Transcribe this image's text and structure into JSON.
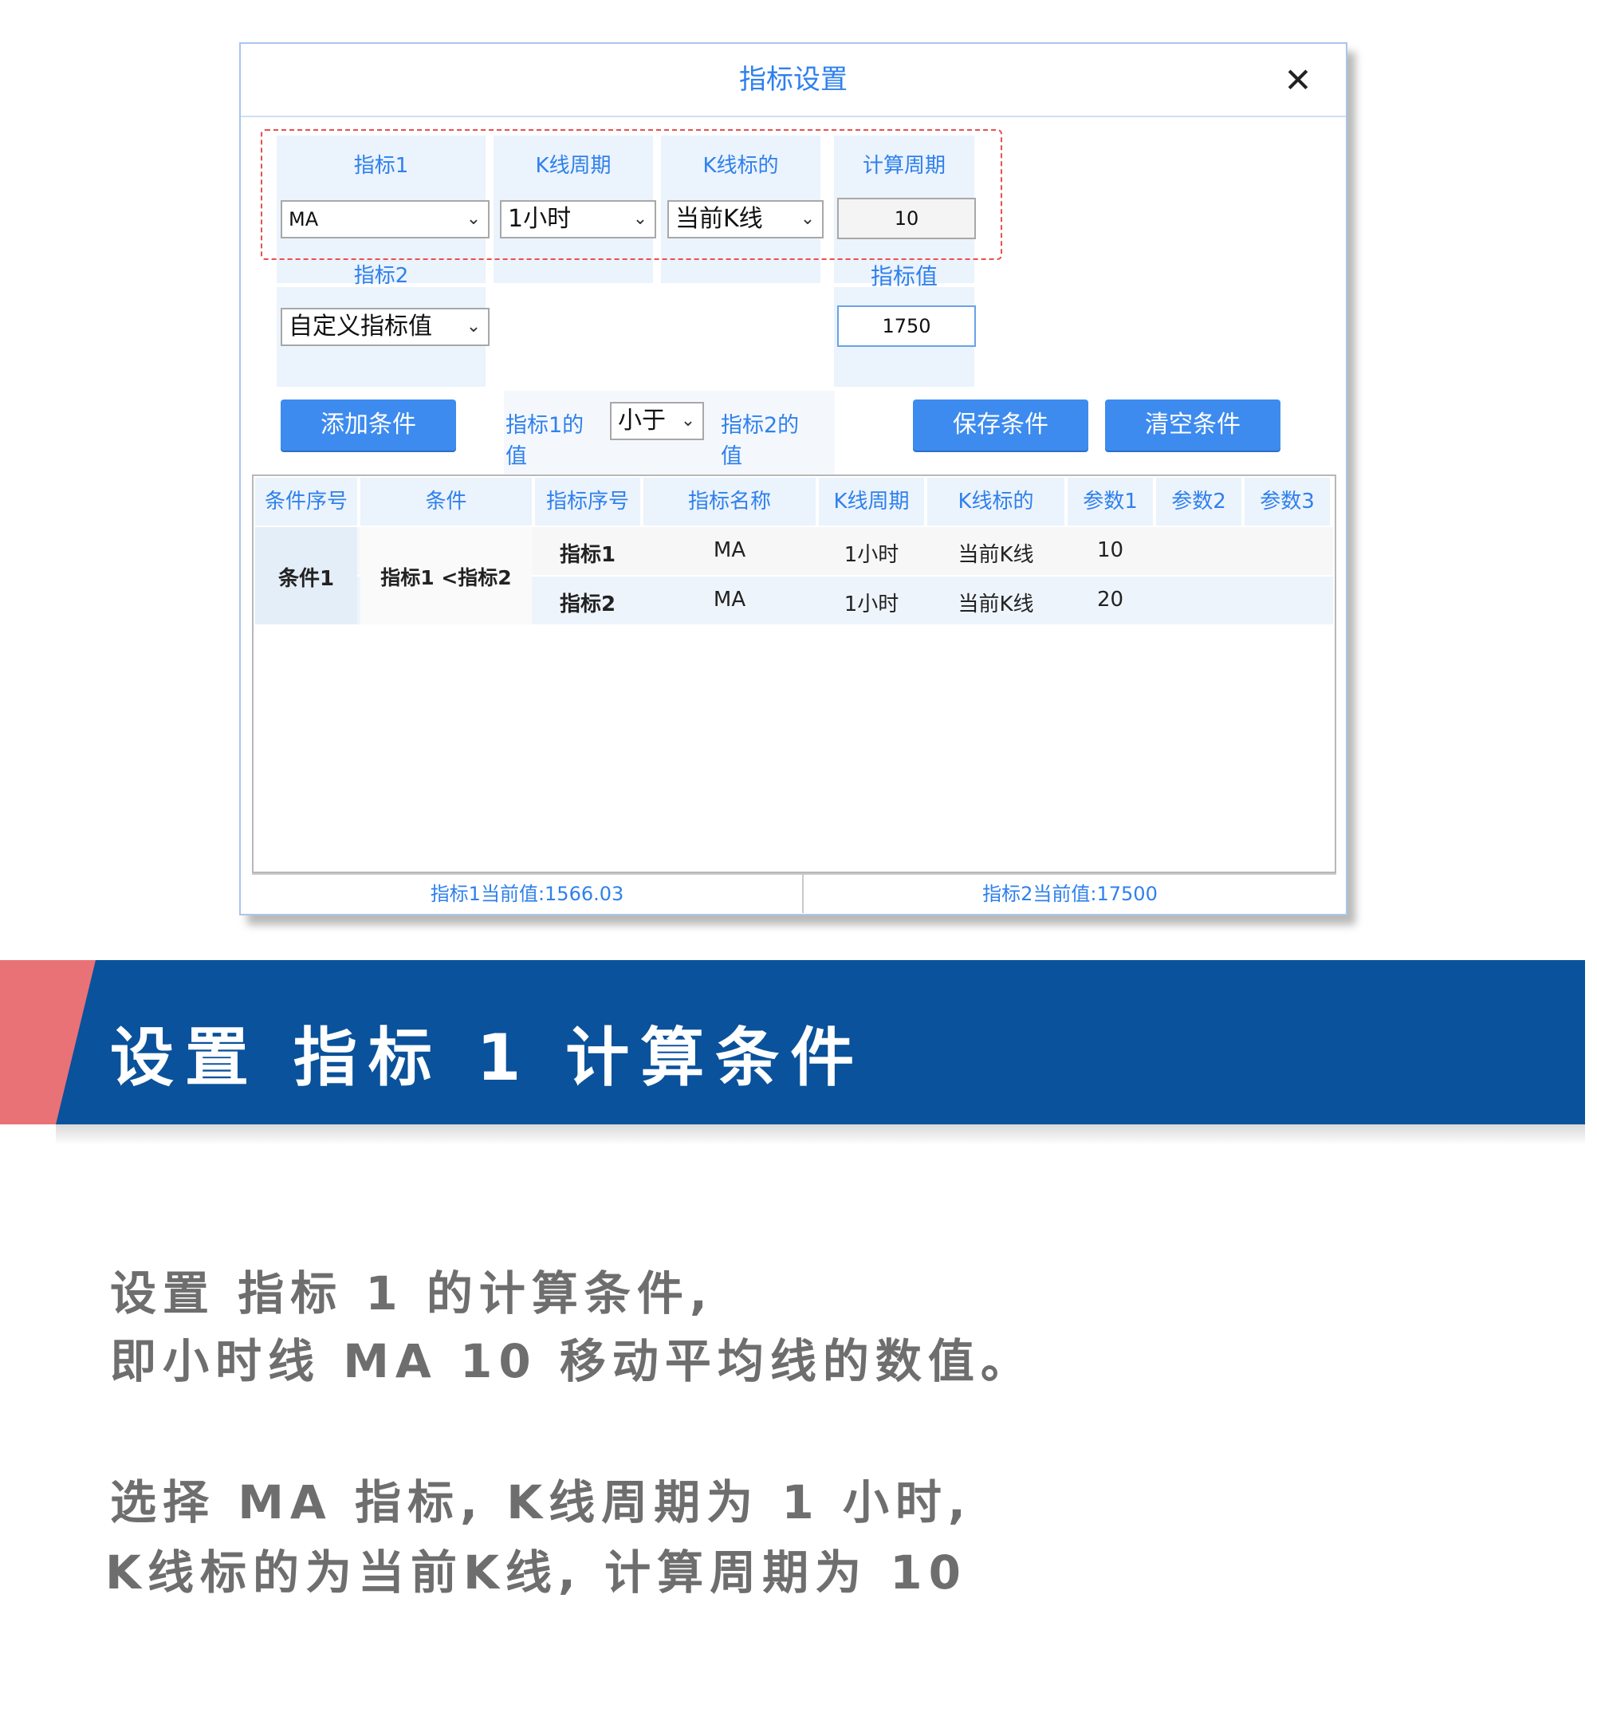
{
  "dialog": {
    "title": "指标设置",
    "close_symbol": "✕",
    "labels": {
      "indicator1": "指标1",
      "kline_period": "K线周期",
      "kline_target": "K线标的",
      "calc_period": "计算周期",
      "indicator2": "指标2",
      "indicator_value": "指标值",
      "ind1_value": "指标1的值",
      "ind2_value": "指标2的值"
    },
    "fields": {
      "indicator1_select": "MA",
      "kline_period_select": "1小时",
      "kline_target_select": "当前K线",
      "calc_period_input": "10",
      "indicator2_select": "自定义指标值",
      "indicator_value_input": "1750",
      "compare_select": "小于"
    },
    "buttons": {
      "add": "添加条件",
      "save": "保存条件",
      "clear": "清空条件"
    },
    "table": {
      "columns": [
        "条件序号",
        "条件",
        "指标序号",
        "指标名称",
        "K线周期",
        "K线标的",
        "参数1",
        "参数2",
        "参数3"
      ],
      "group": {
        "id": "条件1",
        "condition": "指标1 <指标2"
      },
      "rows": [
        [
          "指标1",
          "MA",
          "1小时",
          "当前K线",
          "10",
          "",
          ""
        ],
        [
          "指标2",
          "MA",
          "1小时",
          "当前K线",
          "20",
          "",
          ""
        ]
      ]
    },
    "status": {
      "left": "指标1当前值:1566.03",
      "right": "指标2当前值:17500"
    }
  },
  "banner": {
    "text": "设置 指标 1 计算条件"
  },
  "paragraphs": [
    "设置 指标 1 的计算条件,",
    "即小时线 MA 10 移动平均线的数值。",
    "选择 MA 指标, K线周期为 1 小时,",
    "K线标的为当前K线, 计算周期为 10"
  ],
  "colors": {
    "accent_blue": "#2f80ed",
    "button_blue": "#3d8bef",
    "banner_blue": "#0a529b",
    "banner_red": "#e97277",
    "dashed_red": "#e85050"
  }
}
